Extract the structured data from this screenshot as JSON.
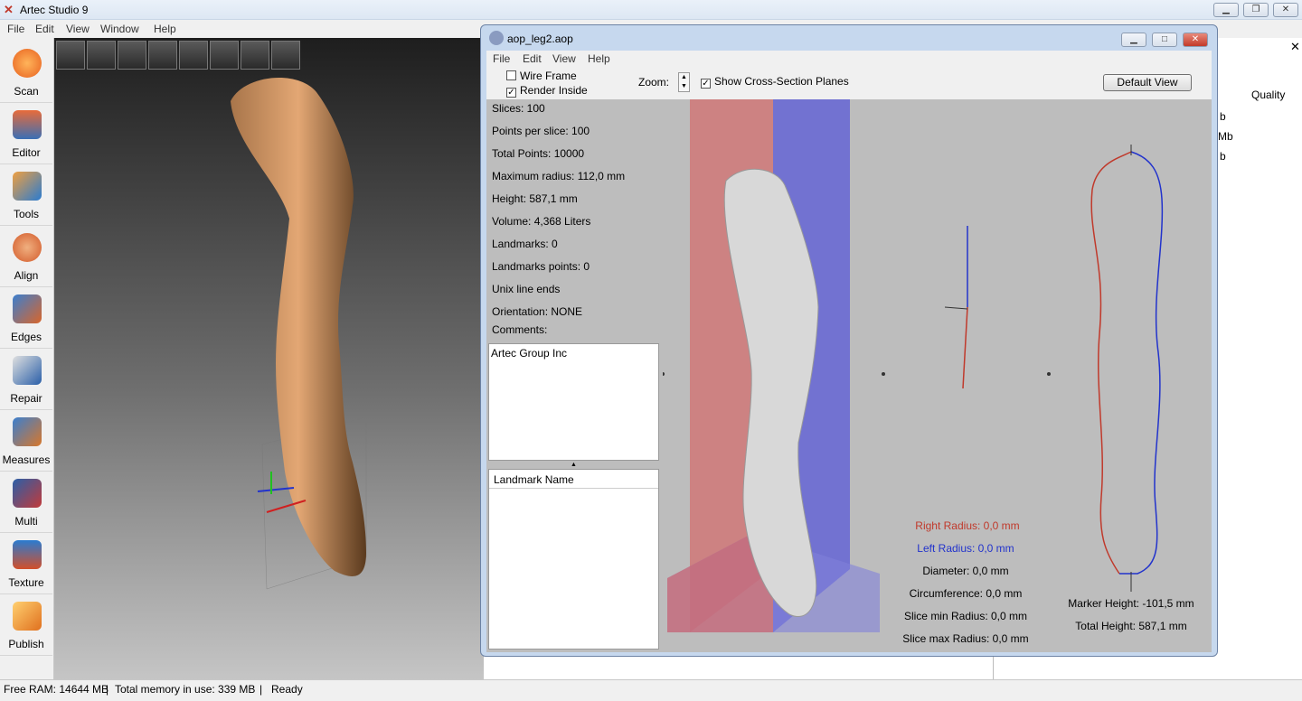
{
  "app": {
    "title": "Artec Studio 9"
  },
  "menu": [
    "File",
    "Edit",
    "View",
    "Window",
    "Help"
  ],
  "tools": [
    {
      "label": "Scan",
      "color": "#e8611f"
    },
    {
      "label": "Editor",
      "color": "#3a6fb5"
    },
    {
      "label": "Tools",
      "color": "#2a7bd0"
    },
    {
      "label": "Align",
      "color": "#d35a2a"
    },
    {
      "label": "Edges",
      "color": "#d9652a"
    },
    {
      "label": "Repair",
      "color": "#2a5fa8"
    },
    {
      "label": "Measures",
      "color": "#d8772a"
    },
    {
      "label": "Multi",
      "color": "#c23a3a"
    },
    {
      "label": "Texture",
      "color": "#d24f2a"
    },
    {
      "label": "Publish",
      "color": "#e0701e"
    }
  ],
  "viewport_tools": [
    "home-icon",
    "fit-icon",
    "axes-icon",
    "light-icon",
    "textured-icon",
    "solid-icon",
    "sphere-icon",
    "crescent-icon"
  ],
  "right_panel": {
    "quality_header": "Quality",
    "values": [
      "b",
      "Mb",
      "b"
    ]
  },
  "status": {
    "free_ram": "Free RAM: 14644 MB",
    "sep1": "|",
    "total_mem": "Total memory in use: 339 MB",
    "sep2": "|",
    "state": "Ready"
  },
  "dialog": {
    "title": "aop_leg2.aop",
    "menu": [
      "File",
      "Edit",
      "View",
      "Help"
    ],
    "wire_frame": "Wire Frame",
    "render_inside": "Render Inside",
    "zoom_label": "Zoom:",
    "show_planes": "Show Cross-Section Planes",
    "default_view": "Default View",
    "info": [
      "Slices: 100",
      "Points per slice: 100",
      "Total Points: 10000",
      "Maximum radius: 112,0 mm",
      "Height: 587,1 mm",
      "Volume: 4,368 Liters",
      "Landmarks: 0",
      "Landmarks points: 0",
      "Unix line ends",
      "Orientation: NONE",
      "Comments:"
    ],
    "comment_text": "Artec Group Inc",
    "landmark_header": "Landmark Name",
    "measures": {
      "right_radius": "Right Radius: 0,0 mm",
      "left_radius": "Left Radius: 0,0 mm",
      "diameter": "Diameter: 0,0 mm",
      "circumference": "Circumference: 0,0 mm",
      "slice_min": "Slice min Radius: 0,0 mm",
      "slice_max": "Slice max Radius: 0,0 mm",
      "marker_height": "Marker Height: -101,5 mm",
      "total_height": "Total Height: 587,1 mm"
    },
    "colors": {
      "right": "#c0392b",
      "left": "#2233cc"
    }
  }
}
